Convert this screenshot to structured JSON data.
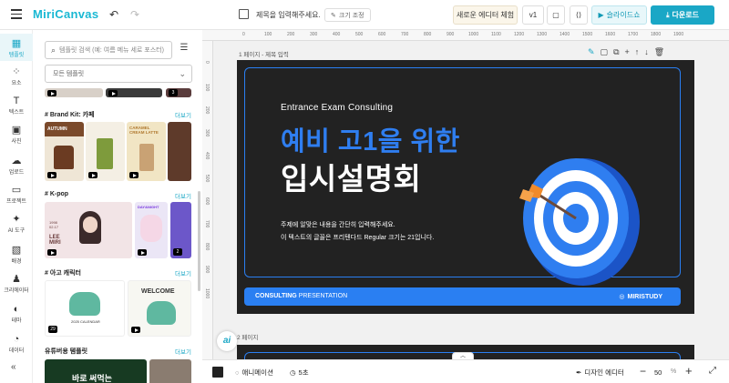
{
  "app": {
    "logo": "MiriCanvas"
  },
  "header": {
    "doc_title": "제목을 입력해주세요.",
    "resize_label": "크기 조정",
    "new_editor_label": "새로운 에디터 체험",
    "version_label": "v1",
    "slideshow_label": "슬라이드쇼",
    "download_label": "다운로드"
  },
  "rail": {
    "items": [
      {
        "label": "템플릿",
        "icon": "template-icon"
      },
      {
        "label": "요소",
        "icon": "elements-icon"
      },
      {
        "label": "텍스트",
        "icon": "text-icon"
      },
      {
        "label": "사진",
        "icon": "photo-icon"
      },
      {
        "label": "업로드",
        "icon": "upload-icon"
      },
      {
        "label": "프로젝트",
        "icon": "project-icon"
      },
      {
        "label": "AI 도구",
        "icon": "ai-tool-icon"
      },
      {
        "label": "배경",
        "icon": "background-icon"
      },
      {
        "label": "크리에이터",
        "icon": "creator-icon"
      },
      {
        "label": "테마",
        "icon": "theme-icon"
      },
      {
        "label": "데이터",
        "icon": "data-icon"
      }
    ]
  },
  "panel": {
    "search_placeholder": "템플릿 검색 (예: 여름 메뉴 세로 포스터)",
    "select_value": "모든 템플릿",
    "more_label": "더보기",
    "sections": [
      {
        "title": "# Brand Kit: 카페"
      },
      {
        "title": "# K-pop"
      },
      {
        "title": "# 아고 캐릭터"
      },
      {
        "title": "유튜버용 템플릿"
      }
    ],
    "thumb_texts": {
      "autumn": "AUTUMN",
      "caramel": "CARAMEL CREAM LATTE",
      "lee_miri": "LEE MIRI",
      "dayandnight": "DAY&NIGHT",
      "calendar": "2025 CALENDAR",
      "welcome": "WELCOME",
      "youtube": "바로 써먹는"
    },
    "thumb_counts": {
      "top3": "3",
      "kpop2": "2",
      "ago29": "29"
    }
  },
  "canvas": {
    "page1_label": "1 페이지 - 제목 입력",
    "page2_label": "2 페이지",
    "slide": {
      "subtitle": "Entrance Exam Consulting",
      "title_line1": "예비 고1을 위한",
      "title_line2": "입시설명회",
      "body_line1": "주제에 알맞은 내용을 간단히 입력해주세요.",
      "body_line2": "이 텍스트의 글꼴은 프리텐다드 Regular 크기는 21입니다.",
      "footer_left_bold": "CONSULTING",
      "footer_left_rest": " PRESENTATION",
      "footer_right": "MIRISTUDY"
    },
    "ruler_ticks": [
      "0",
      "100",
      "200",
      "300",
      "400",
      "500",
      "600",
      "700",
      "800",
      "900",
      "1000",
      "1100",
      "1200",
      "1300",
      "1400",
      "1500",
      "1600",
      "1700",
      "1800",
      "1900"
    ],
    "ruler_v_ticks": [
      "0",
      "100",
      "200",
      "300",
      "400",
      "500",
      "600",
      "700",
      "800",
      "900",
      "1000"
    ]
  },
  "bottombar": {
    "animation_label": "애니메이션",
    "duration_label": "5초",
    "design_editor_label": "디자인 에디터",
    "zoom_value": "50",
    "zoom_unit": "%"
  },
  "colors": {
    "accent": "#1aa7c6",
    "slide_bg": "#222222",
    "slide_blue": "#2a7ff2"
  }
}
